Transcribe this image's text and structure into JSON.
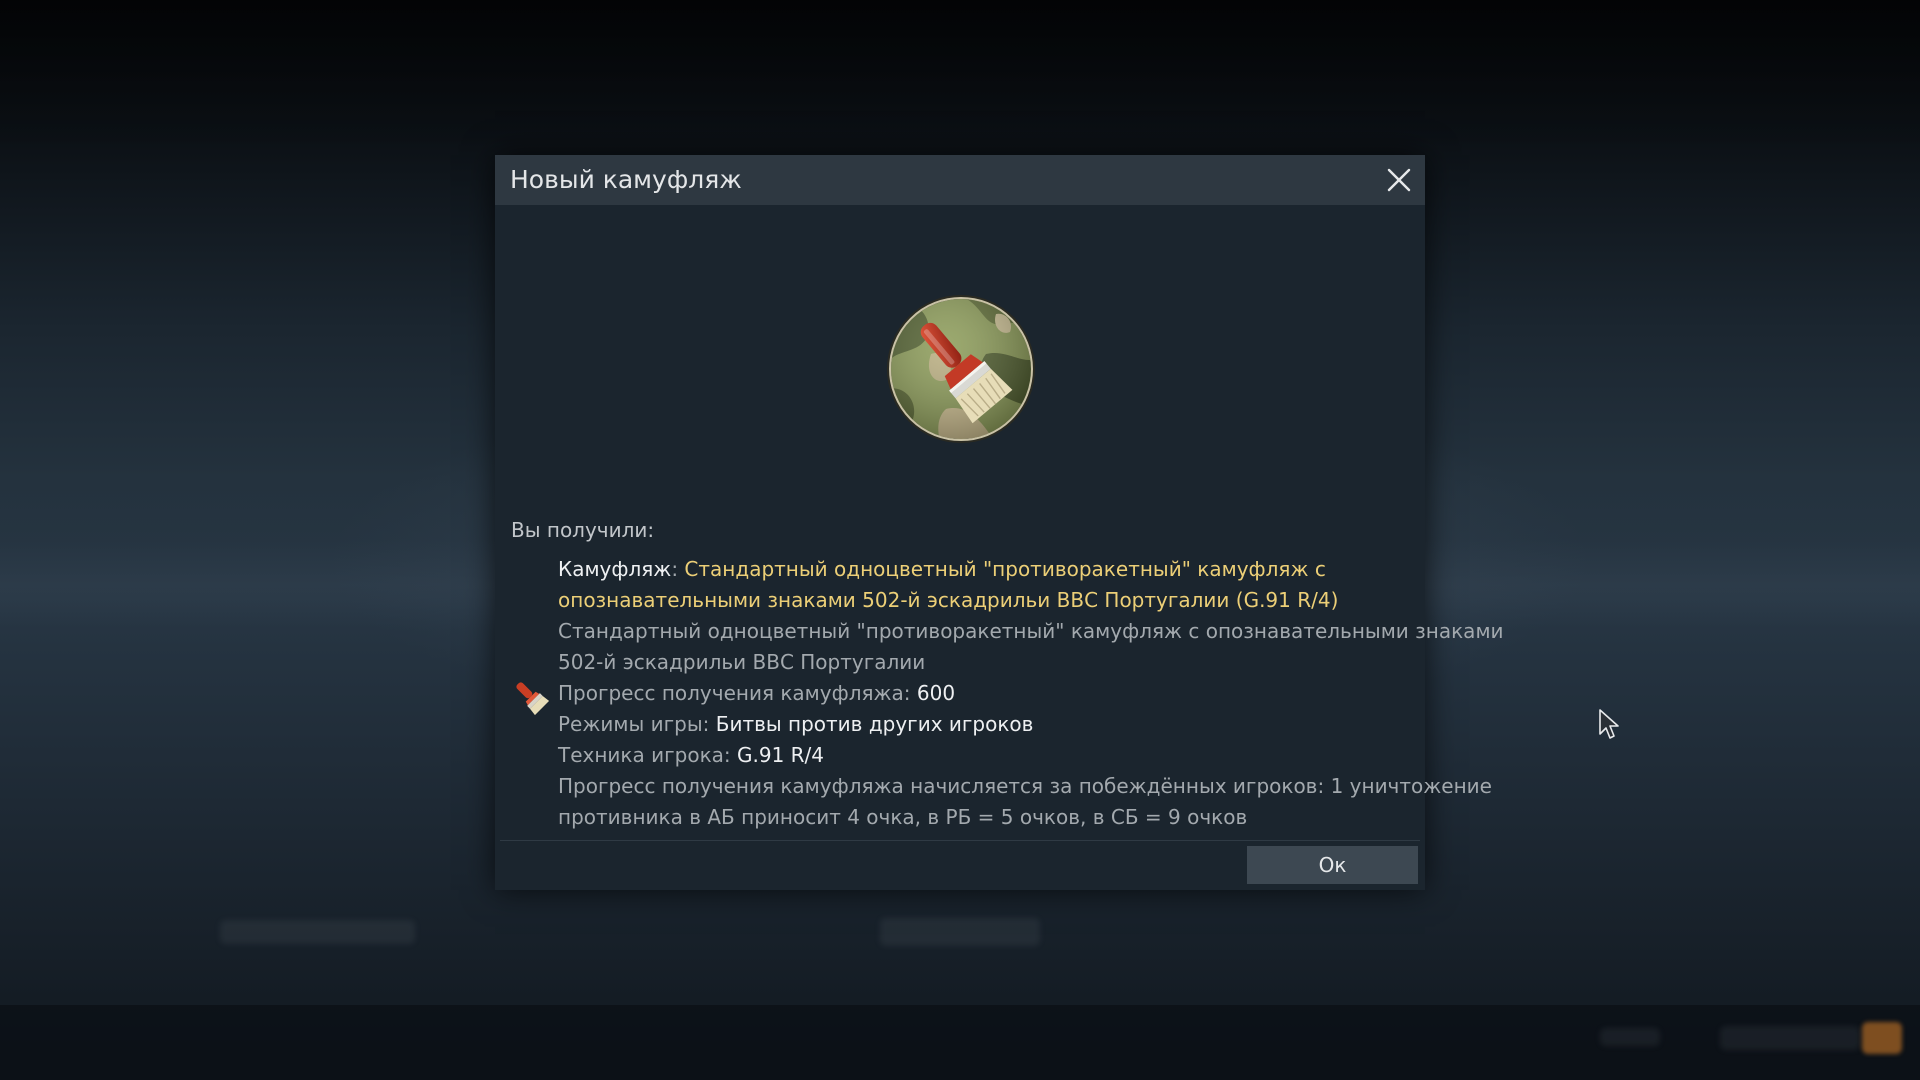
{
  "dialog": {
    "title": "Новый камуфляж",
    "close_icon": "close-icon",
    "emblem_icon": "camouflage-paintbrush-icon",
    "received_label": "Вы получили:",
    "reward_icon": "paintbrush-icon",
    "camouflage_label": "Камуфляж",
    "camouflage_separator": ": ",
    "camouflage_name_line1": "Стандартный одноцветный \"противоракетный\" камуфляж с",
    "camouflage_name_line2": "опознавательными знаками 502-й эскадрильи ВВС Португалии (G.91 R/4)",
    "description_line1": "Стандартный одноцветный \"противоракетный\" камуфляж с опознавательными знаками",
    "description_line2": "502-й эскадрильи ВВС Португалии",
    "progress_label": "Прогресс получения камуфляжа: ",
    "progress_value": "600",
    "modes_label": "Режимы игры: ",
    "modes_value": "Битвы против других игроков",
    "vehicle_label": "Техника игрока: ",
    "vehicle_value": "G.91 R/4",
    "note_line1": "Прогресс получения камуфляжа начисляется за побеждённых игроков: 1 уничтожение",
    "note_line2": "противника в АБ приносит 4 очка, в РБ = 5 очков, в СБ = 9 очков",
    "ok_label": "Ок"
  },
  "colors": {
    "header_bg": "#2e3841",
    "body_bg": "#1b252e",
    "highlight_yellow": "#eccf77",
    "ok_button_bg": "#3d4852"
  }
}
